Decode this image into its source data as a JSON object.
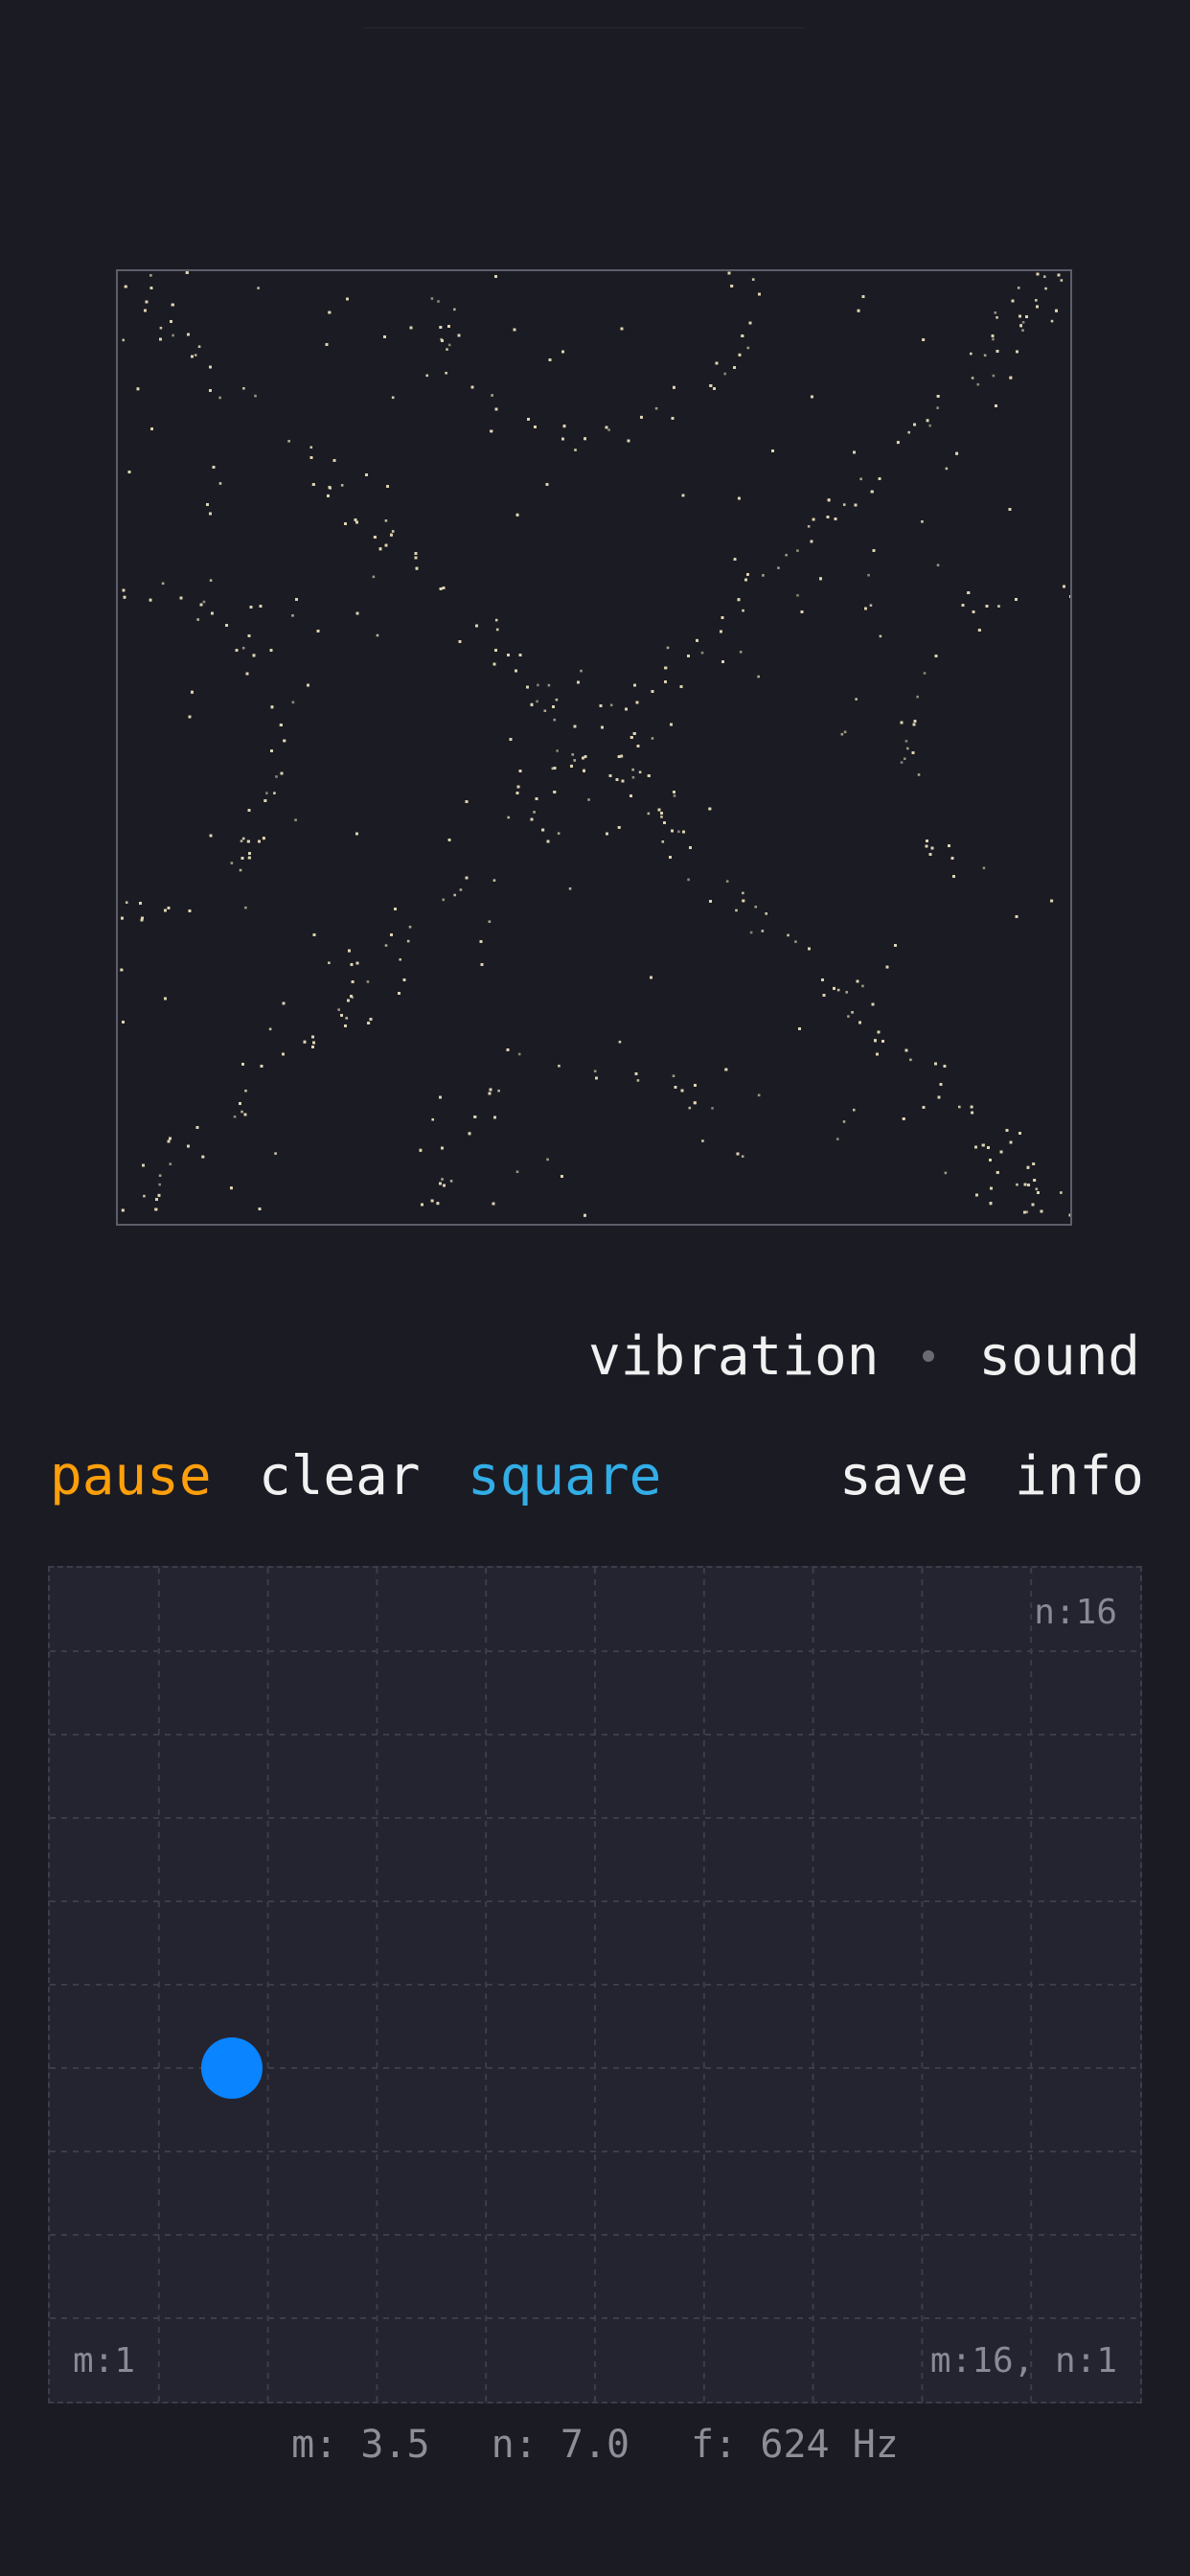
{
  "mode": {
    "vibration_label": "vibration",
    "sound_label": "sound",
    "separator_icon": "dot-separator"
  },
  "controls": {
    "pause_label": "pause",
    "clear_label": "clear",
    "square_label": "square",
    "save_label": "save",
    "info_label": "info"
  },
  "pad": {
    "top_right_label": "n:16",
    "bottom_left_label": "m:1",
    "bottom_right_label": "m:16, n:1",
    "knob_m": 3.5,
    "knob_n": 7.0
  },
  "readout": {
    "m": "m: 3.5",
    "n": "n: 7.0",
    "f": "f: 624 Hz"
  },
  "colors": {
    "background": "#1b1b24",
    "pad_background": "#242430",
    "pause": "#ff9f0a",
    "square": "#32ade6",
    "knob": "#0a84ff",
    "particles": "#ddd4b0",
    "text": "#f1f1f1"
  }
}
